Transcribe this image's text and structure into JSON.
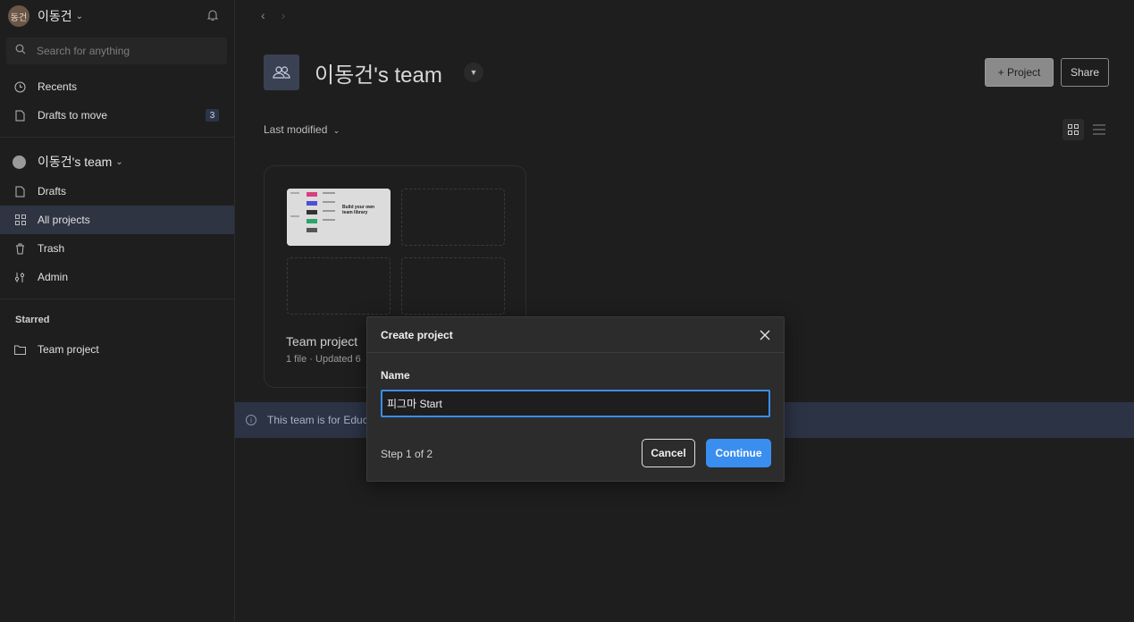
{
  "sidebar": {
    "user": {
      "avatar_text": "동건",
      "name": "이동건"
    },
    "search_placeholder": "Search for anything",
    "recents_label": "Recents",
    "drafts_to_move_label": "Drafts to move",
    "drafts_to_move_count": "3",
    "team_name": "이동건's team",
    "drafts_label": "Drafts",
    "all_projects_label": "All projects",
    "trash_label": "Trash",
    "admin_label": "Admin",
    "starred_header": "Starred",
    "starred_item": "Team project"
  },
  "header": {
    "title": "이동건's team",
    "project_button": "+ Project",
    "share_button": "Share",
    "sort_label": "Last modified"
  },
  "project_card": {
    "title": "Team project",
    "meta": "1 file · Updated 6",
    "thumbnail_text": "Build your own team library"
  },
  "banner": {
    "text": "This team is for Educa"
  },
  "modal": {
    "title": "Create project",
    "name_label": "Name",
    "name_value": "피그마 Start",
    "step_text": "Step 1 of 2",
    "cancel_label": "Cancel",
    "continue_label": "Continue"
  },
  "colors": {
    "accent": "#3a8ef0",
    "active_nav": "#2f3443",
    "banner": "#2c3345"
  }
}
